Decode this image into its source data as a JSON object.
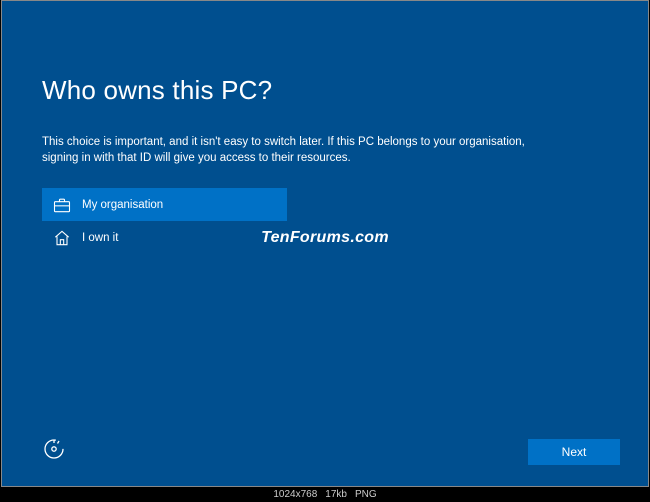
{
  "setup": {
    "title": "Who owns this PC?",
    "description": "This choice is important, and it isn't easy to switch later. If this PC belongs to your organisation, signing in with that ID will give you access to their resources.",
    "options": {
      "org": "My organisation",
      "own": "I own it"
    },
    "next_label": "Next"
  },
  "watermark": "TenForums.com",
  "imginfo": {
    "dims": "1024x768",
    "size": "17kb",
    "fmt": "PNG"
  }
}
